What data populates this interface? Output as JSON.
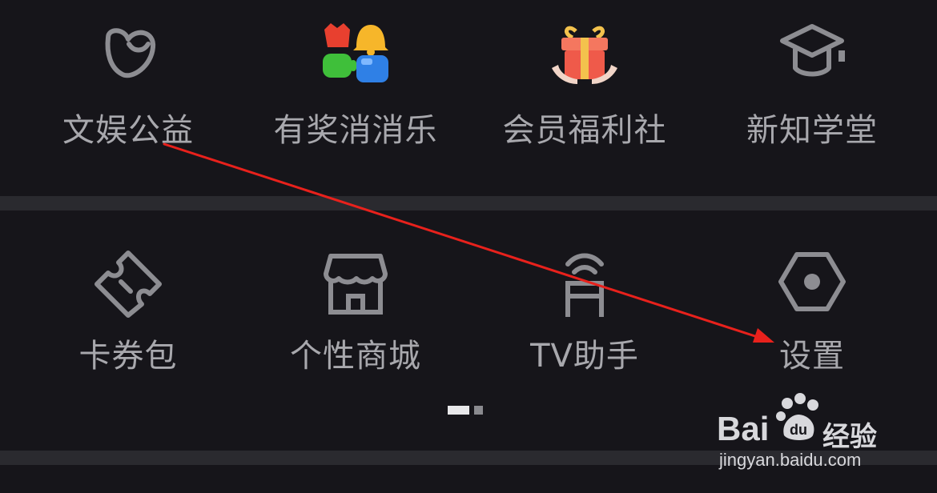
{
  "row1": [
    {
      "label": "文娱公益",
      "icon": "heart-bubble-icon"
    },
    {
      "label": "有奖消消乐",
      "icon": "match-game-icon"
    },
    {
      "label": "会员福利社",
      "icon": "gift-box-icon"
    },
    {
      "label": "新知学堂",
      "icon": "graduation-cap-icon"
    }
  ],
  "row2": [
    {
      "label": "卡券包",
      "icon": "ticket-icon"
    },
    {
      "label": "个性商城",
      "icon": "store-icon"
    },
    {
      "label": "TV助手",
      "icon": "tv-antenna-icon"
    },
    {
      "label": "设置",
      "icon": "settings-hexagon-icon"
    }
  ],
  "pager": {
    "pages": 2,
    "current": 1
  },
  "watermark": {
    "brand": "Bai",
    "brand_paw": "du",
    "brand_suffix": "经验",
    "url": "jingyan.baidu.com"
  },
  "colors": {
    "background": "#16151a",
    "label": "#a8a8ad",
    "divider": "#2a2a2f",
    "arrow": "#e8211c"
  }
}
